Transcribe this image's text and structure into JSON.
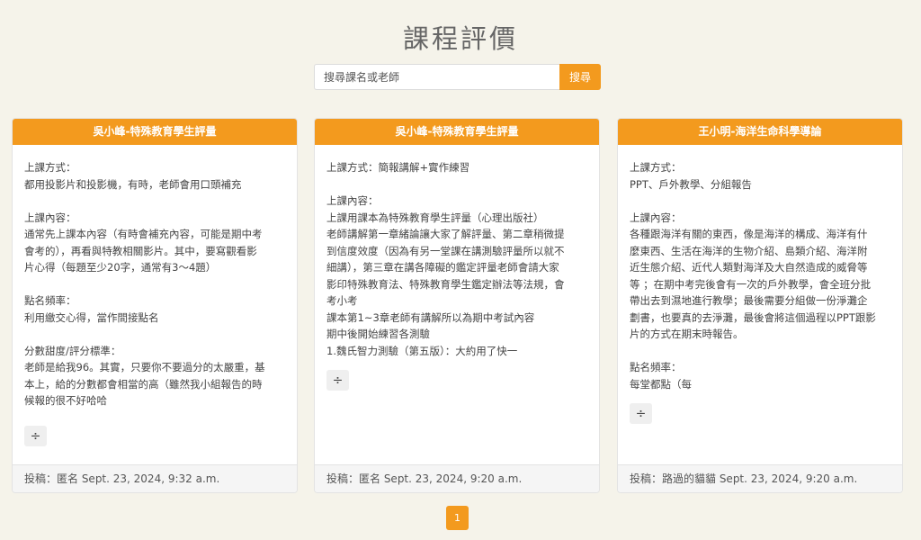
{
  "page": {
    "title": "課程評價"
  },
  "search": {
    "placeholder": "搜尋課名或老師",
    "button_label": "搜尋"
  },
  "reviews": [
    {
      "title": "吳小峰-特殊教育學生評量",
      "sections": [
        {
          "text": "上課方式：\n都用投影片和投影機，有時，老師會用口頭補充"
        },
        {
          "text": "上課內容：\n通常先上課本內容（有時會補充內容，可能是期中考\n會考的），再看與特教相關影片。其中，要寫觀看影\n片心得（每題至少20字，通常有3～4題）"
        },
        {
          "text": "點名頻率：\n利用繳交心得，當作間接點名"
        },
        {
          "text": "分數甜度/評分標準：\n老師是給我96。其實，只要你不要過分的太嚴重，基\n本上，給的分數都會相當的高（雖然我小組報告的時\n候報的很不好哈哈"
        }
      ],
      "expand_symbol": "÷",
      "footer": "投稿：匿名 Sept. 23, 2024, 9:32 a.m."
    },
    {
      "title": "吳小峰-特殊教育學生評量",
      "sections": [
        {
          "text": "上課方式：簡報講解+實作練習"
        },
        {
          "text": "上課內容：\n上課用課本為特殊教育學生評量（心理出版社）\n老師講解第一章緒論讓大家了解評量、第二章稍微提\n到信度效度（因為有另一堂課在講測驗評量所以就不\n細講），第三章在講各障礙的鑑定評量老師會請大家\n影印特殊教育法、特殊教育學生鑑定辦法等法規，會\n考小考\n課本第1~3章老師有講解所以為期中考試內容\n期中後開始練習各測驗\n1.魏氏智力測驗（第五版）：大約用了快一"
        }
      ],
      "expand_symbol": "÷",
      "footer": "投稿：匿名 Sept. 23, 2024, 9:20 a.m."
    },
    {
      "title": "王小明-海洋生命科學導論",
      "sections": [
        {
          "text": "上課方式：\nPPT、戶外教學、分組報告"
        },
        {
          "text": "上課內容：\n各種跟海洋有關的東西，像是海洋的構成、海洋有什\n麼東西、生活在海洋的生物介紹、島類介紹、海洋附\n近生態介紹、近代人類對海洋及大自然造成的威脅等\n等 ；在期中考完後會有一次的戶外教學，會全班分批\n帶出去到濕地進行教學；最後需要分組做一份淨灘企\n劃書，也要真的去淨灘，最後會將這個過程以PPT跟影\n片的方式在期末時報告。"
        },
        {
          "text": "點名頻率：\n每堂都點（每"
        }
      ],
      "expand_symbol": "÷",
      "footer": "投稿：路過的貓貓 Sept. 23, 2024, 9:20 a.m."
    }
  ],
  "pagination": {
    "current": "1"
  },
  "colors": {
    "accent": "#f39a1e",
    "background": "#f5f3ea"
  }
}
